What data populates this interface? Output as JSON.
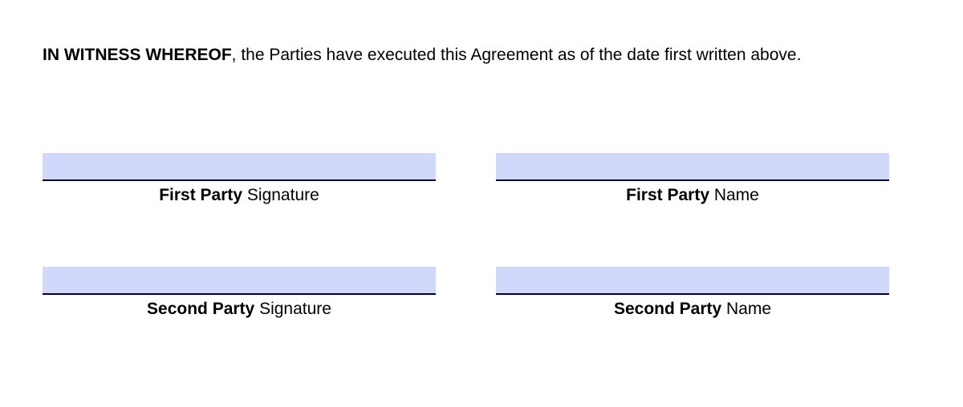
{
  "intro": {
    "bold": "IN WITNESS WHEREOF",
    "text": ", the Parties have executed this Agreement as of the date first written above."
  },
  "fields": {
    "first_party_signature": {
      "bold": "First Party",
      "suffix": " Signature",
      "value": ""
    },
    "first_party_name": {
      "bold": "First Party",
      "suffix": " Name",
      "value": ""
    },
    "second_party_signature": {
      "bold": "Second Party",
      "suffix": " Signature",
      "value": ""
    },
    "second_party_name": {
      "bold": "Second Party",
      "suffix": " Name",
      "value": ""
    }
  },
  "colors": {
    "field_fill": "#d0d9fb",
    "field_underline": "#000033"
  }
}
